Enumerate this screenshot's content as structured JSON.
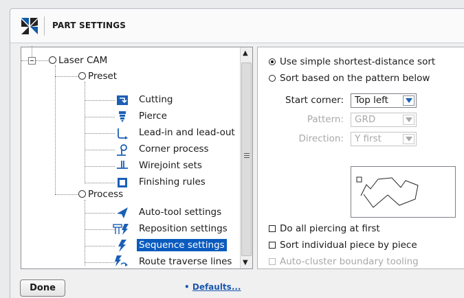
{
  "header": {
    "title": "PART SETTINGS",
    "logo_icon": "pinwheel-logo-icon"
  },
  "tree": {
    "root": {
      "label": "Laser CAM",
      "expand_icon": "collapse-minus-icon"
    },
    "groups": [
      {
        "label": "Preset",
        "items": [
          {
            "label": "Cutting",
            "icon": "cutting-icon"
          },
          {
            "label": "Pierce",
            "icon": "pierce-icon"
          },
          {
            "label": "Lead-in and lead-out",
            "icon": "lead-in-out-icon"
          },
          {
            "label": "Corner process",
            "icon": "corner-process-icon"
          },
          {
            "label": "Wirejoint sets",
            "icon": "wirejoint-icon"
          },
          {
            "label": "Finishing rules",
            "icon": "finishing-rules-icon"
          }
        ]
      },
      {
        "label": "Process",
        "items": [
          {
            "label": "Auto-tool settings",
            "icon": "auto-tool-icon"
          },
          {
            "label": "Reposition settings",
            "icon": "reposition-icon"
          },
          {
            "label": "Sequence settings",
            "icon": "sequence-icon",
            "selected": true
          },
          {
            "label": "Route traverse lines",
            "icon": "route-traverse-icon"
          }
        ]
      }
    ]
  },
  "settings": {
    "sort_options": [
      {
        "label": "Use simple shortest-distance sort",
        "selected": true
      },
      {
        "label": "Sort based on the pattern below",
        "selected": false
      }
    ],
    "start_corner": {
      "label": "Start corner:",
      "value": "Top left"
    },
    "pattern": {
      "label": "Pattern:",
      "value": "GRD"
    },
    "direction": {
      "label": "Direction:",
      "value": "Y first"
    },
    "checkboxes": [
      {
        "label": "Do all piercing at first",
        "checked": false,
        "enabled": true
      },
      {
        "label": "Sort individual piece by piece",
        "checked": false,
        "enabled": true
      },
      {
        "label": "Auto-cluster boundary tooling",
        "checked": false,
        "enabled": false
      }
    ]
  },
  "footer": {
    "done_label": "Done",
    "defaults_bullet": "•",
    "defaults_label": "Defaults..."
  },
  "colors": {
    "accent": "#0a5bbf",
    "icon_blue": "#1b5fb5",
    "disabled_text": "#a8a8a8"
  }
}
